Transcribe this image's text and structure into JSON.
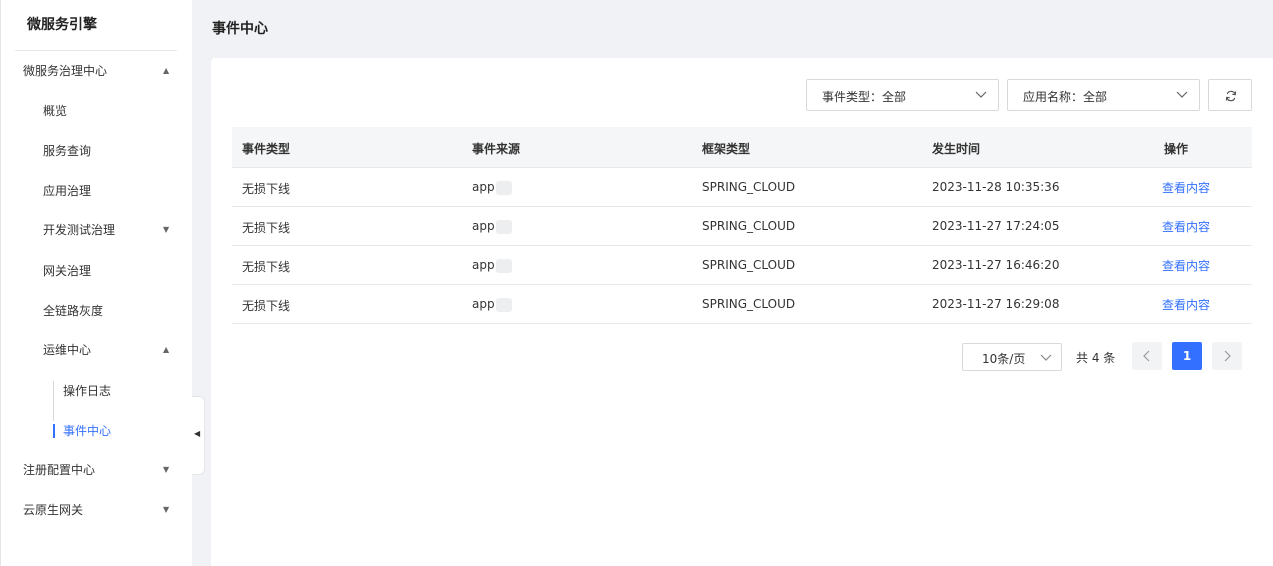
{
  "sidebar": {
    "title": "微服务引擎",
    "items": [
      {
        "label": "微服务治理中心",
        "arrow": "▲"
      },
      {
        "label": "概览"
      },
      {
        "label": "服务查询"
      },
      {
        "label": "应用治理"
      },
      {
        "label": "开发测试治理",
        "arrow": "▼"
      },
      {
        "label": "网关治理"
      },
      {
        "label": "全链路灰度"
      },
      {
        "label": "运维中心",
        "arrow": "▲"
      },
      {
        "label": "操作日志"
      },
      {
        "label": "事件中心"
      },
      {
        "label": "注册配置中心",
        "arrow": "▼"
      },
      {
        "label": "云原生网关",
        "arrow": "▼"
      }
    ],
    "collapse_glyph": "◀"
  },
  "header": {
    "title": "事件中心"
  },
  "filters": {
    "event_type": "事件类型：全部",
    "app_name": "应用名称：全部"
  },
  "table": {
    "columns": [
      "事件类型",
      "事件来源",
      "框架类型",
      "发生时间",
      "操作"
    ],
    "rows": [
      {
        "type": "无损下线",
        "source": "app",
        "framework": "SPRING_CLOUD",
        "time": "2023-11-28 10:35:36",
        "action": "查看内容"
      },
      {
        "type": "无损下线",
        "source": "app",
        "framework": "SPRING_CLOUD",
        "time": "2023-11-27 17:24:05",
        "action": "查看内容"
      },
      {
        "type": "无损下线",
        "source": "app",
        "framework": "SPRING_CLOUD",
        "time": "2023-11-27 16:46:20",
        "action": "查看内容"
      },
      {
        "type": "无损下线",
        "source": "app",
        "framework": "SPRING_CLOUD",
        "time": "2023-11-27 16:29:08",
        "action": "查看内容"
      }
    ]
  },
  "pagination": {
    "page_size": "10条/页",
    "total": "共 4 条",
    "current_page": "1"
  },
  "colors": {
    "accent": "#3370ff",
    "background": "#f0f2f5"
  }
}
